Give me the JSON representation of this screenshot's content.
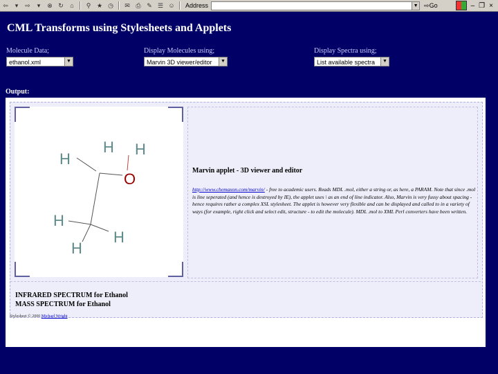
{
  "toolbar": {
    "address_label": "Address",
    "address_value": "",
    "go_label": "Go",
    "close_glyph": "×"
  },
  "page": {
    "title": "CML Transforms using Stylesheets and Applets"
  },
  "controls": {
    "molecule": {
      "label": "Molecule Data;",
      "value": "ethanol.xml"
    },
    "display": {
      "label": "Display Molecules using;",
      "value": "Marvin 3D viewer/editor"
    },
    "spectra": {
      "label": "Display Spectra using;",
      "value": "List available spectra"
    }
  },
  "output": {
    "label": "Output:",
    "molecule_atoms": [
      {
        "symbol": "H"
      },
      {
        "symbol": "H"
      },
      {
        "symbol": "H"
      },
      {
        "symbol": "O"
      },
      {
        "symbol": "H"
      },
      {
        "symbol": "H"
      },
      {
        "symbol": "H"
      }
    ],
    "applet_title": "Marvin applet - 3D viewer and editor",
    "applet_link": "http://www.chemaxon.com/marvin/",
    "applet_text": " - free to academic users. Reads MDL .mol, either a string or, as here, a PARAM. Note that since .mol is line seperated (and hence is destroyed by IE), the applet uses \\ as an end of line indicator. Also, Marvin is very fussy about spacing - hence requires rather a complex XSL stylesheet. The applet is however very flexible and can be displayed and called to in a variety of ways (for example, right click and select edit, structure - to edit the molecule). MDL .mol to XML Perl converters have been written.",
    "spectra": [
      "INFRARED SPECTRUM for Ethanol",
      "MASS SPECTRUM for Ethanol"
    ],
    "credit_text": "Stylesheet © 2000 ",
    "credit_link": "Michael Wright"
  },
  "colors": {
    "background": "#000066",
    "hydrogen": "#5f8a8a",
    "oxygen": "#990000"
  }
}
